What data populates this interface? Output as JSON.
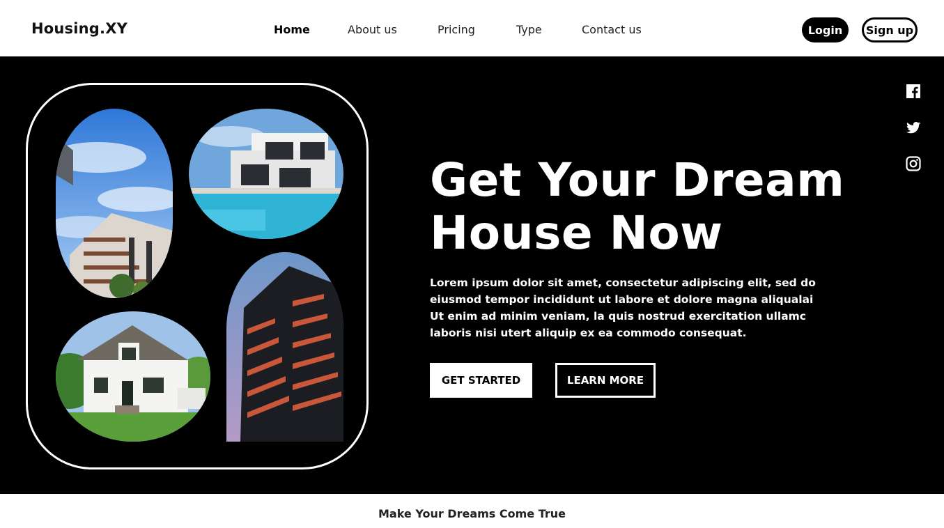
{
  "header": {
    "brand": "Housing.XY",
    "nav": [
      {
        "label": "Home",
        "active": true
      },
      {
        "label": "About us",
        "active": false
      },
      {
        "label": "Pricing",
        "active": false
      },
      {
        "label": "Type",
        "active": false
      },
      {
        "label": "Contact us",
        "active": false
      }
    ],
    "login_label": "Login",
    "signup_label": "Sign up"
  },
  "hero": {
    "headline": [
      "Get Your Dream",
      "House Now"
    ],
    "paragraph": [
      "Lorem ipsum dolor sit amet, consectetur adipiscing elit, sed do",
      "eiusmod tempor incididunt ut labore et dolore magna aliqualai",
      "Ut enim ad minim veniam,  la quis nostrud exercitation ullamc",
      "laboris nisi utert aliquip ex ea commodo consequat."
    ],
    "get_started_label": "GET STARTED",
    "learn_more_label": "LEARN MORE",
    "gallery": [
      {
        "icon": "apartment-tower-sky-photo"
      },
      {
        "icon": "villa-pool-photo"
      },
      {
        "icon": "white-house-lawn-photo"
      },
      {
        "icon": "highrise-balconies-photo"
      }
    ]
  },
  "social": [
    {
      "icon": "facebook-icon"
    },
    {
      "icon": "twitter-icon"
    },
    {
      "icon": "instagram-icon"
    }
  ],
  "footer": {
    "tagline": "Make Your Dreams Come True"
  },
  "colors": {
    "hero_background": "#000000",
    "page_background": "#ffffff",
    "accent_orange": "#d4583a"
  }
}
